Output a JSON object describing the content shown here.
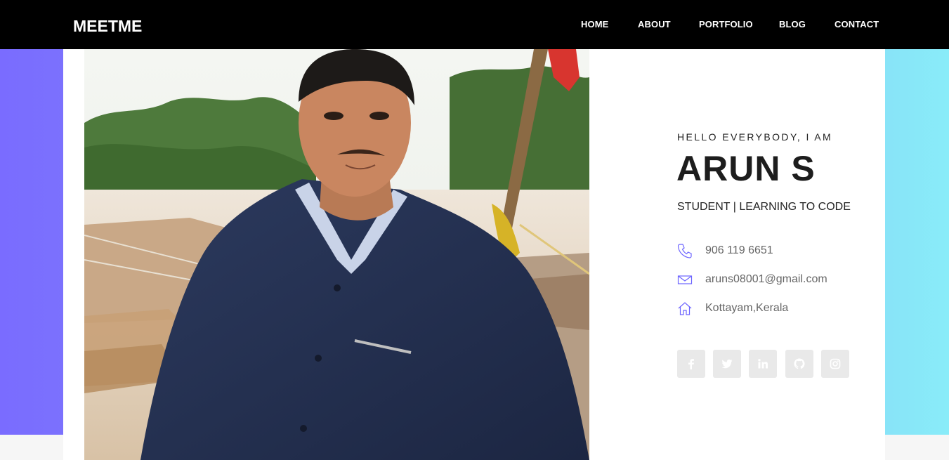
{
  "nav": {
    "brand": "MEETME",
    "items": [
      {
        "label": "HOME"
      },
      {
        "label": "ABOUT"
      },
      {
        "label": "PORTFOLIO"
      },
      {
        "label": "BLOG"
      },
      {
        "label": "CONTACT"
      }
    ]
  },
  "hero": {
    "greeting": "HELLO EVERYBODY, I AM",
    "name": "ARUN S",
    "role": "STUDENT | LEARNING TO CODE",
    "contacts": [
      {
        "icon": "phone-icon",
        "text": "906 119 6651"
      },
      {
        "icon": "mail-icon",
        "text": "aruns08001@gmail.com"
      },
      {
        "icon": "home-icon",
        "text": "Kottayam,Kerala"
      }
    ],
    "socials": [
      {
        "icon": "facebook-icon"
      },
      {
        "icon": "twitter-icon"
      },
      {
        "icon": "linkedin-icon"
      },
      {
        "icon": "github-icon"
      },
      {
        "icon": "instagram-icon"
      }
    ]
  },
  "colors": {
    "accent": "#6c63ff",
    "gradient_left": "#7a6cff",
    "gradient_right": "#89ecf9",
    "navbar": "#000000"
  }
}
